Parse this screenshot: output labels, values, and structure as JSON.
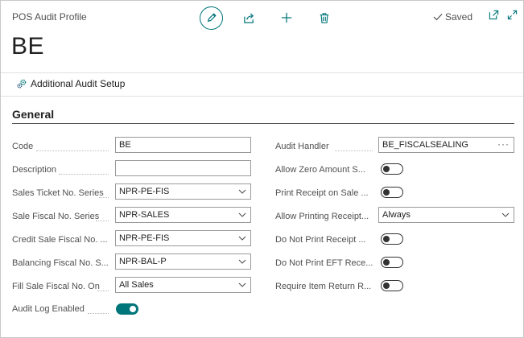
{
  "header": {
    "page_type": "POS Audit Profile",
    "title": "BE",
    "saved_label": "Saved"
  },
  "actions": {
    "additional_audit_setup": "Additional Audit Setup"
  },
  "section": {
    "title": "General"
  },
  "left_fields": [
    {
      "label": "Code",
      "value": "BE",
      "kind": "text"
    },
    {
      "label": "Description",
      "value": "",
      "kind": "text"
    },
    {
      "label": "Sales Ticket No. Series",
      "value": "NPR-PE-FIS",
      "kind": "select"
    },
    {
      "label": "Sale Fiscal No. Series",
      "value": "NPR-SALES",
      "kind": "select"
    },
    {
      "label": "Credit Sale Fiscal No. ...",
      "value": "NPR-PE-FIS",
      "kind": "select"
    },
    {
      "label": "Balancing Fiscal No. S...",
      "value": "NPR-BAL-P",
      "kind": "select"
    },
    {
      "label": "Fill Sale Fiscal No. On",
      "value": "All Sales",
      "kind": "select"
    },
    {
      "label": "Audit Log Enabled",
      "value": "on",
      "kind": "toggle"
    }
  ],
  "right_fields": [
    {
      "label": "Audit Handler",
      "value": "BE_FISCALSEALING",
      "kind": "lookup"
    },
    {
      "label": "Allow Zero Amount S...",
      "value": "off",
      "kind": "toggle"
    },
    {
      "label": "Print Receipt on Sale ...",
      "value": "off",
      "kind": "toggle"
    },
    {
      "label": "Allow Printing Receipt...",
      "value": "Always",
      "kind": "select"
    },
    {
      "label": "Do Not Print Receipt ...",
      "value": "off",
      "kind": "toggle"
    },
    {
      "label": "Do Not Print EFT Rece...",
      "value": "off",
      "kind": "toggle"
    },
    {
      "label": "Require Item Return R...",
      "value": "off",
      "kind": "toggle"
    }
  ],
  "colors": {
    "accent": "#00757a",
    "text": "#212121",
    "muted": "#505050"
  }
}
